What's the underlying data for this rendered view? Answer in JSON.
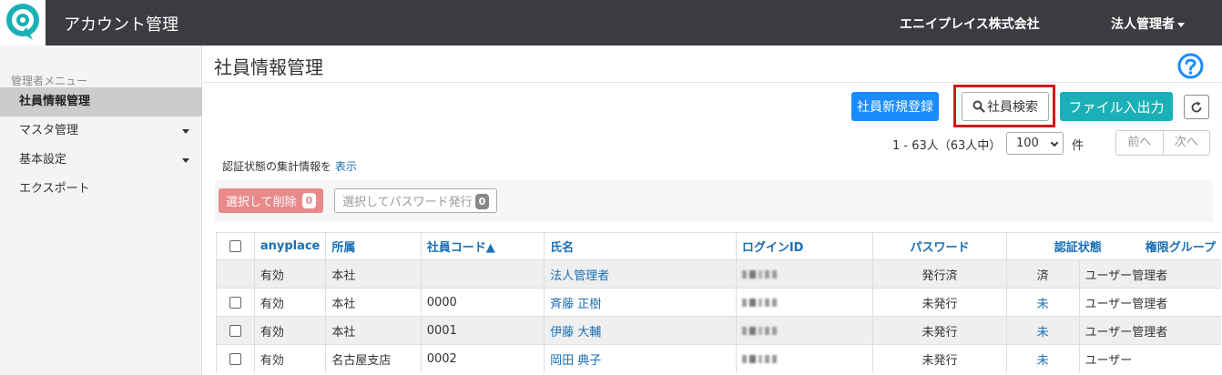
{
  "header": {
    "app_title": "アカウント管理",
    "company": "エニイプレイス株式会社",
    "user_menu": "法人管理者"
  },
  "sidebar": {
    "heading": "管理者メニュー",
    "items": [
      {
        "label": "社員情報管理",
        "active": true
      },
      {
        "label": "マスタ管理",
        "dropdown": true
      },
      {
        "label": "基本設定",
        "dropdown": true
      },
      {
        "label": "エクスポート"
      }
    ]
  },
  "page": {
    "title": "社員情報管理",
    "help_icon": "question-circle-icon"
  },
  "toolbar": {
    "new_label": "社員新規登録",
    "search_label": "社員検索",
    "file_label": "ファイル入出力",
    "refresh_icon": "refresh-icon"
  },
  "paging": {
    "info": "1 - 63人（63人中）",
    "per_page": "100",
    "unit": "件",
    "prev": "前へ",
    "next": "次へ"
  },
  "summary": {
    "text": "認証状態の集計情報を",
    "link": "表示"
  },
  "bulk": {
    "delete_label": "選択して削除",
    "delete_count": "0",
    "password_label": "選択してパスワード発行",
    "password_count": "0"
  },
  "table": {
    "columns": [
      "anyplace",
      "所属",
      "社員コード▲",
      "氏名",
      "ログインID",
      "パスワード",
      "認証状態",
      "権限グループ"
    ],
    "rows": [
      {
        "checkbox": false,
        "anyplace": "有効",
        "dept": "本社",
        "code": "",
        "name": "法人管理者",
        "password": "発行済",
        "auth": "済",
        "group": "ユーザー管理者"
      },
      {
        "checkbox": true,
        "anyplace": "有効",
        "dept": "本社",
        "code": "0000",
        "name": "斉藤 正樹",
        "password": "未発行",
        "auth": "未",
        "group": "ユーザー管理者"
      },
      {
        "checkbox": true,
        "anyplace": "有効",
        "dept": "本社",
        "code": "0001",
        "name": "伊藤 大輔",
        "password": "未発行",
        "auth": "未",
        "group": "ユーザー管理者"
      },
      {
        "checkbox": true,
        "anyplace": "有効",
        "dept": "名古屋支店",
        "code": "0002",
        "name": "岡田 典子",
        "password": "未発行",
        "auth": "未",
        "group": "ユーザー"
      }
    ]
  },
  "colors": {
    "topbar": "#3a3c40",
    "primary": "#1a8cff",
    "teal": "#1bb0b8",
    "highlight": "#d41818",
    "link": "#1a6fb5"
  }
}
